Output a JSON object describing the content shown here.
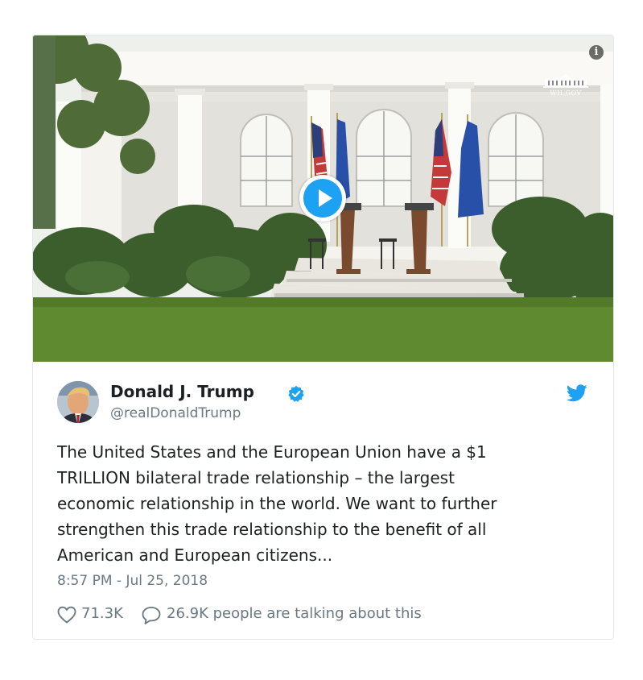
{
  "media": {
    "play_label": "Play video",
    "watermark": "WH.GOV",
    "info_glyph": "i"
  },
  "tweet": {
    "author_name": "Donald J. Trump",
    "handle": "@realDonaldTrump",
    "text": "The United States and the European Union have a $1\nTRILLION bilateral trade relationship – the largest\neconomic relationship in the world. We want to further\nstrengthen this trade relationship to the benefit of all\nAmerican and European citizens...",
    "timestamp": "8:57 PM - Jul 25, 2018",
    "likes": "71.3K",
    "talking": "26.9K people are talking about this"
  },
  "icons": {
    "verified": "verified-badge-icon",
    "bird": "twitter-bird-icon",
    "heart": "heart-icon",
    "reply": "speech-bubble-icon",
    "info": "info-icon",
    "play": "play-icon"
  },
  "colors": {
    "accent": "#1da1f2",
    "text": "#1c2022",
    "muted": "#697882",
    "border": "#e1e8ed"
  }
}
